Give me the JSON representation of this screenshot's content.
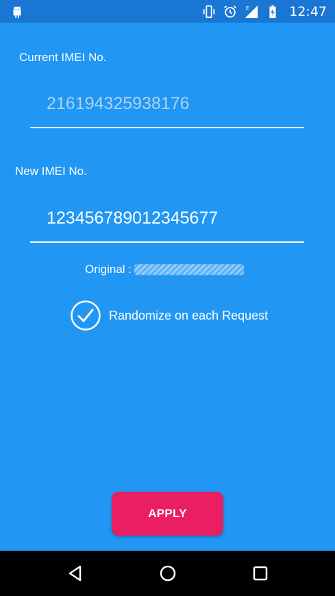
{
  "status_bar": {
    "time": "12:47",
    "icons": [
      "android-debug-icon",
      "vibrate-icon",
      "alarm-icon",
      "signal-e-icon",
      "battery-charging-icon"
    ]
  },
  "form": {
    "current_label": "Current IMEI No.",
    "current_value": "216194325938176",
    "new_label": "New IMEI No.",
    "new_value": "123456789012345677",
    "original_label": "Original :",
    "randomize_label": "Randomize on each Request",
    "randomize_checked": true
  },
  "actions": {
    "apply_label": "APPLY"
  },
  "colors": {
    "background": "#2196F3",
    "status_bar": "#1976D2",
    "accent": "#E91E63",
    "nav_bar": "#000000"
  },
  "nav": {
    "icons": [
      "back-icon",
      "home-icon",
      "recents-icon"
    ]
  }
}
